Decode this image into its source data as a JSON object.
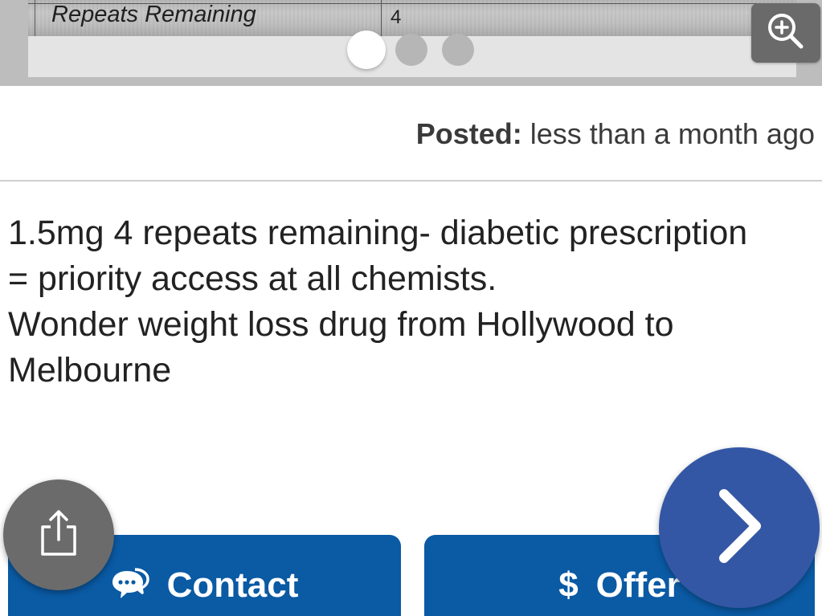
{
  "carousel": {
    "image_table": {
      "label": "Repeats Remaining",
      "value": "4"
    },
    "page_count": 3,
    "current_page": 1,
    "zoom_icon": "zoom-in-icon"
  },
  "listing": {
    "posted_label": "Posted:",
    "posted_value": " less than a month ago",
    "description_lines": [
      "1.5mg 4 repeats remaining- diabetic prescription",
      "= priority access at all chemists.",
      "Wonder weight loss drug from Hollywood to",
      "Melbourne"
    ]
  },
  "actions": {
    "contact_label": "Contact",
    "contact_icon": "chat-bubbles-icon",
    "offer_label": "Offer",
    "offer_icon": "$",
    "share_icon": "share-icon",
    "next_icon": "chevron-right-icon"
  },
  "colors": {
    "primary_button": "#0a5aa4",
    "next_fab": "#3457a5",
    "share_fab": "#6b6b6b",
    "divider": "#cfcfcf"
  }
}
